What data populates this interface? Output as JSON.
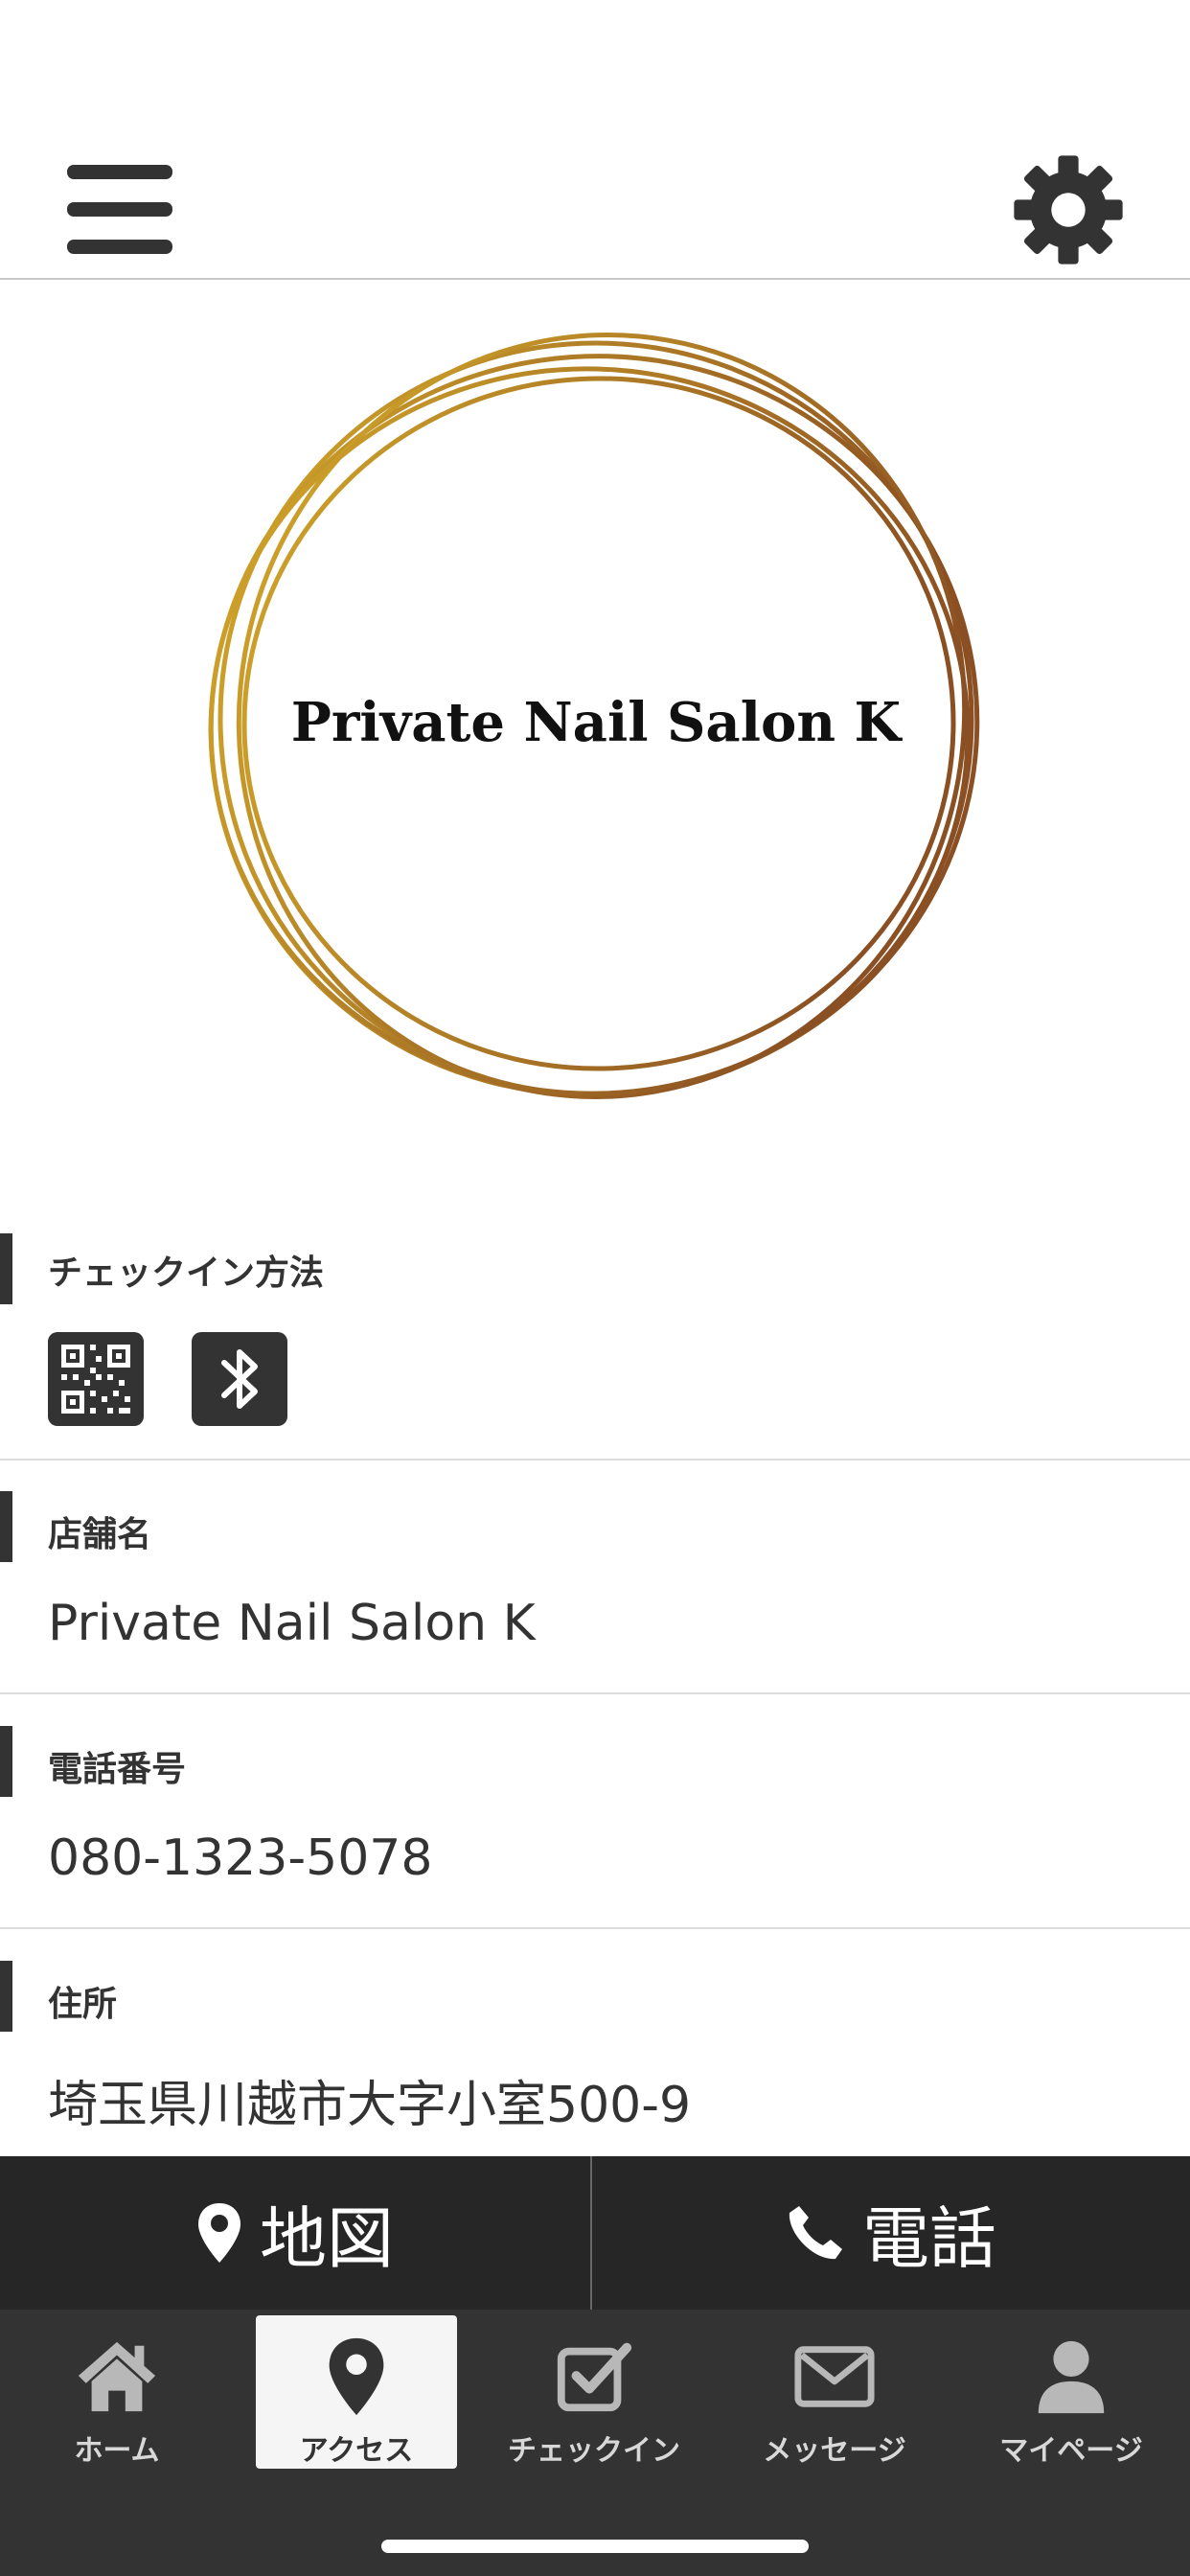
{
  "header": {
    "menu_icon": "hamburger-menu-icon",
    "settings_icon": "gear-icon"
  },
  "logo": {
    "text": "Private Nail Salon K",
    "ring_colors": [
      "#d4a92a",
      "#8a4f22"
    ]
  },
  "sections": {
    "checkin": {
      "label": "チェックイン方法",
      "icons": [
        "qr-code-icon",
        "bluetooth-icon"
      ]
    },
    "store_name": {
      "label": "店舗名",
      "value": "Private Nail Salon K"
    },
    "phone": {
      "label": "電話番号",
      "value": "080-1323-5078"
    },
    "address": {
      "label": "住所",
      "value": "埼玉県川越市大字小室500-9"
    }
  },
  "actions": {
    "map_label": "地図",
    "call_label": "電話"
  },
  "tabs": [
    {
      "label": "ホーム",
      "icon": "home-icon"
    },
    {
      "label": "アクセス",
      "icon": "map-pin-icon",
      "active": true
    },
    {
      "label": "チェックイン",
      "icon": "check-square-icon"
    },
    {
      "label": "メッセージ",
      "icon": "envelope-icon"
    },
    {
      "label": "マイページ",
      "icon": "user-icon"
    }
  ],
  "colors": {
    "bar_dark": "#262626",
    "tab_bg": "#333333",
    "accent_text": "#333333"
  }
}
